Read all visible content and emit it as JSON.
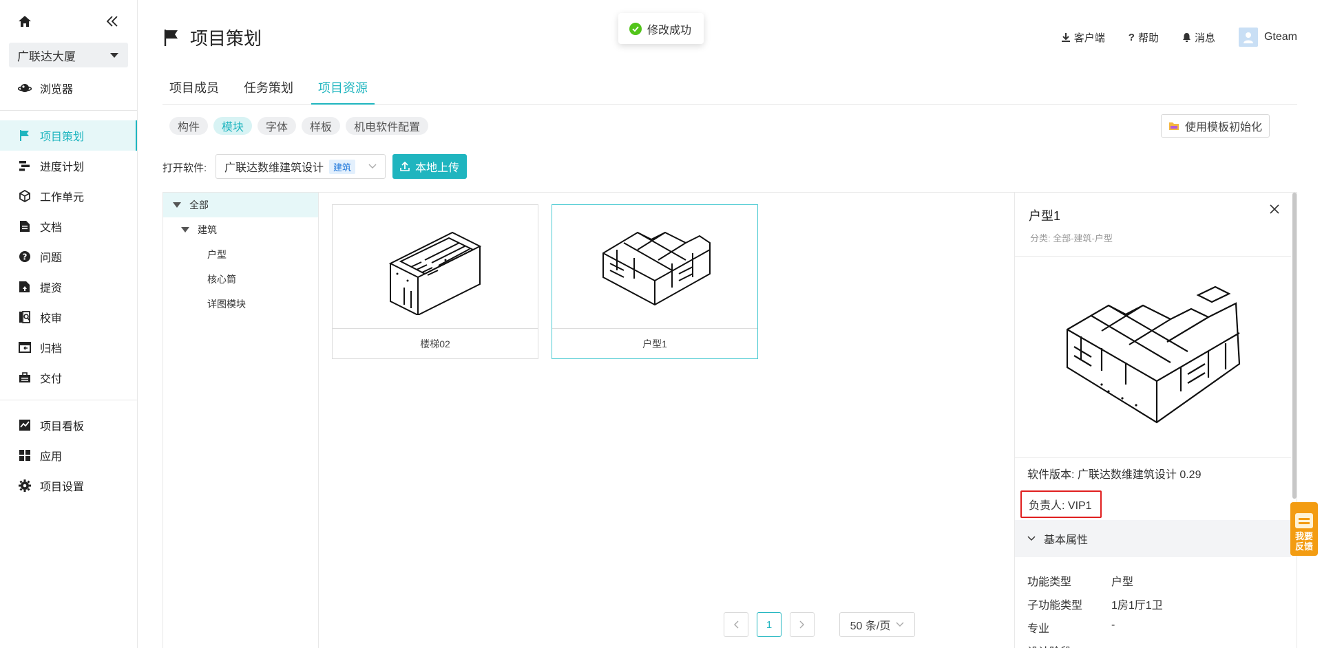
{
  "sidebar": {
    "project": "广联达大厦",
    "group1": [
      {
        "label": "浏览器",
        "icon": "planet-icon"
      }
    ],
    "group2": [
      {
        "label": "项目策划",
        "icon": "flag-icon",
        "active": true
      },
      {
        "label": "进度计划",
        "icon": "gantt-icon"
      },
      {
        "label": "工作单元",
        "icon": "cube-icon"
      },
      {
        "label": "文档",
        "icon": "document-icon"
      },
      {
        "label": "问题",
        "icon": "question-circle-icon"
      },
      {
        "label": "提资",
        "icon": "submit-doc-icon"
      },
      {
        "label": "校审",
        "icon": "review-icon"
      },
      {
        "label": "归档",
        "icon": "archive-icon"
      },
      {
        "label": "交付",
        "icon": "briefcase-icon"
      }
    ],
    "group3": [
      {
        "label": "项目看板",
        "icon": "chart-board-icon"
      },
      {
        "label": "应用",
        "icon": "apps-icon"
      },
      {
        "label": "项目设置",
        "icon": "gear-icon"
      }
    ]
  },
  "header": {
    "title": "项目策划",
    "client": "客户端",
    "help": "帮助",
    "messages": "消息",
    "user": "Gteam"
  },
  "toast": "修改成功",
  "tabs": [
    "项目成员",
    "任务策划",
    "项目资源"
  ],
  "active_tab": "项目资源",
  "chips": [
    "构件",
    "模块",
    "字体",
    "样板",
    "机电软件配置"
  ],
  "active_chip": "模块",
  "init_button": "使用模板初始化",
  "software": {
    "label": "打开软件:",
    "value": "广联达数维建筑设计",
    "tag": "建筑"
  },
  "upload_button": "本地上传",
  "tree": {
    "root": "全部",
    "node": "建筑",
    "leaves": [
      "户型",
      "核心筒",
      "详图模块"
    ]
  },
  "cards": [
    {
      "name": "楼梯02"
    },
    {
      "name": "户型1",
      "selected": true
    }
  ],
  "pagination": {
    "current": "1",
    "page_size": "50 条/页"
  },
  "detail": {
    "title": "户型1",
    "category": "分类: 全部-建筑-户型",
    "version": "软件版本: 广联达数维建筑设计 0.29",
    "owner": "负责人: VIP1",
    "section": "基本属性",
    "props": [
      {
        "k": "功能类型",
        "v": "户型"
      },
      {
        "k": "子功能类型",
        "v": "1房1厅1卫"
      },
      {
        "k": "专业",
        "v": "-"
      },
      {
        "k": "设计阶段",
        "v": ""
      }
    ]
  },
  "feedback": [
    "我要",
    "反馈"
  ],
  "colors": {
    "accent": "#1fb5bf",
    "highlight": "#e01f1f",
    "feedback": "#f39c12"
  }
}
